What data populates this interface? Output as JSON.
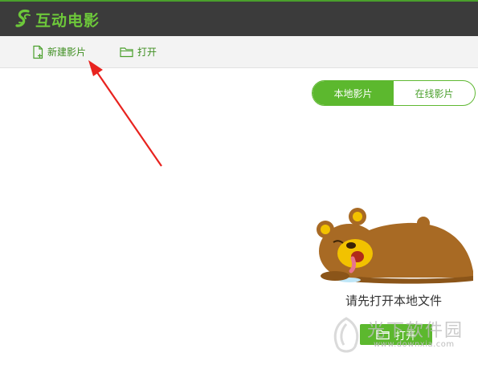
{
  "app": {
    "title": "互动电影",
    "accent_color": "#5cb82e",
    "titlebar_color": "#3b3b3b"
  },
  "toolbar": {
    "new_label": "新建影片",
    "new_icon": "new-file-icon",
    "open_label": "打开",
    "open_icon": "folder-icon"
  },
  "tabs": {
    "local": "本地影片",
    "online": "在线影片",
    "active": "local"
  },
  "empty_state": {
    "message": "请先打开本地文件",
    "open_button": "打开",
    "illustration": "sleeping-bear"
  },
  "annotation": {
    "color": "#e8231f",
    "target": "new-movie-button"
  },
  "watermark": {
    "text_cn": "光下软件园",
    "url": "www.downxia.com"
  }
}
